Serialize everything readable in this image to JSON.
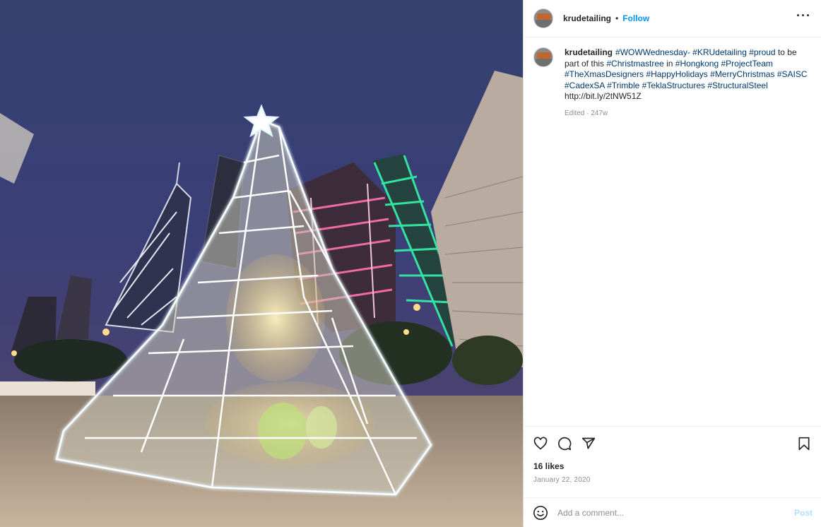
{
  "post": {
    "username": "krudetailing",
    "follow_label": "Follow",
    "more_icon": "more-options-icon",
    "caption": {
      "username": "krudetailing",
      "parts": [
        {
          "type": "tag",
          "text": "#WOWWednesday-"
        },
        {
          "type": "tag",
          "text": "#KRUdetailing"
        },
        {
          "type": "tag",
          "text": "#proud"
        },
        {
          "type": "text",
          "text": "to be part of this"
        },
        {
          "type": "tag",
          "text": "#Christmastree"
        },
        {
          "type": "text",
          "text": "in"
        },
        {
          "type": "tag",
          "text": "#Hongkong"
        },
        {
          "type": "tag",
          "text": "#ProjectTeam"
        },
        {
          "type": "tag",
          "text": "#TheXmasDesigners"
        },
        {
          "type": "tag",
          "text": "#HappyHolidays"
        },
        {
          "type": "tag",
          "text": "#MerryChristmas"
        },
        {
          "type": "tag",
          "text": "#SAISC"
        },
        {
          "type": "tag",
          "text": "#CadexSA"
        },
        {
          "type": "tag",
          "text": "#Trimble"
        },
        {
          "type": "tag",
          "text": "#TeklaStructures"
        },
        {
          "type": "tag",
          "text": "#StructuralSteel"
        },
        {
          "type": "link",
          "text": "http://bit.ly/2tNW51Z"
        }
      ],
      "meta": "Edited · 247w"
    },
    "likes": "16 likes",
    "date": "January 22, 2020",
    "comment_placeholder": "Add a comment...",
    "post_label": "Post",
    "photo_alt": "photo",
    "colors": {
      "link_blue": "#0095f6",
      "hashtag": "#00376b",
      "muted": "#8e8e8e",
      "border": "#dbdbdb"
    }
  }
}
